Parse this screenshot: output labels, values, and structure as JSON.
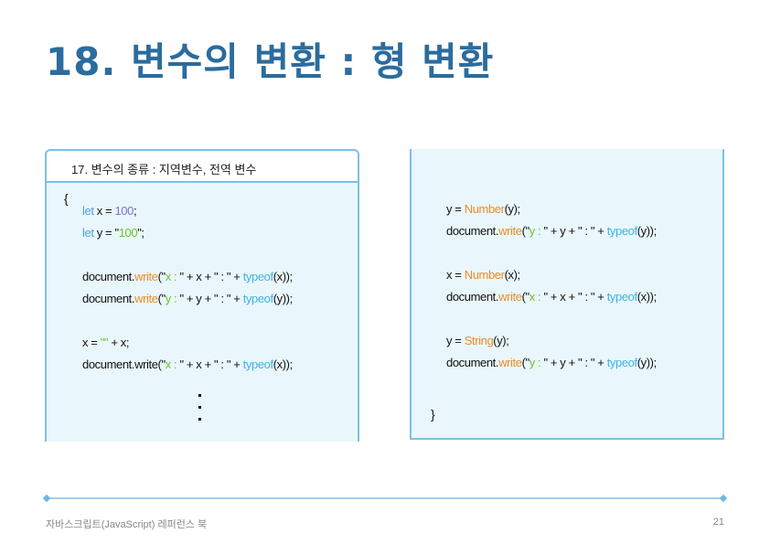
{
  "title": "18. 변수의 변환 : 형 변환",
  "left_panel": {
    "header": "17. 변수의 종류 : 지역변수, 전역 변수",
    "brace_open": "{",
    "l1": {
      "kw": "let",
      "rest": " x = ",
      "num": "100",
      "end": ";"
    },
    "l2": {
      "kw": "let",
      "rest": " y = \"",
      "str": "100",
      "end": "\";"
    },
    "l3": {
      "a": "document.",
      "fn": "write",
      "b": "(\"",
      "s": "x : ",
      "c": "\" + x + \" : \" + ",
      "t": "typeof",
      "d": "(x));"
    },
    "l4": {
      "a": "document.",
      "fn": "write",
      "b": "(\"",
      "s": "y : ",
      "c": "\" + y + \" : \" + ",
      "t": "typeof",
      "d": "(y));"
    },
    "l5": {
      "a": "x = ",
      "s": "\"\"",
      "b": " + x;"
    },
    "l6": {
      "a": "document.write(\"",
      "s": "x : ",
      "c": "\" + x + \" : \" + ",
      "t": "typeof",
      "d": "(x));"
    }
  },
  "right_panel": {
    "r1": {
      "a": "y = ",
      "fn": "Number",
      "b": "(y);"
    },
    "r2": {
      "a": "document.",
      "fn": "write",
      "b": "(\"",
      "s": "y : ",
      "c": "\" + y + \" : \" + ",
      "t": "typeof",
      "d": "(y));"
    },
    "r3": {
      "a": "x = ",
      "fn": "Number",
      "b": "(x);"
    },
    "r4": {
      "a": "document.",
      "fn": "write",
      "b": "(\"",
      "s": "x : ",
      "c": "\" + x + \"  : \" + ",
      "t": "typeof",
      "d": "(x));"
    },
    "r5": {
      "a": "y = ",
      "fn": "String",
      "b": "(y);"
    },
    "r6": {
      "a": "document.",
      "fn": "write",
      "b": "(\"",
      "s": "y : ",
      "c": "\" + y + \" : \" + ",
      "t": "typeof",
      "d": "(y));"
    },
    "brace_close": "}"
  },
  "footer": {
    "book": "자바스크립트(JavaScript) 레퍼런스 북",
    "page": "21"
  }
}
